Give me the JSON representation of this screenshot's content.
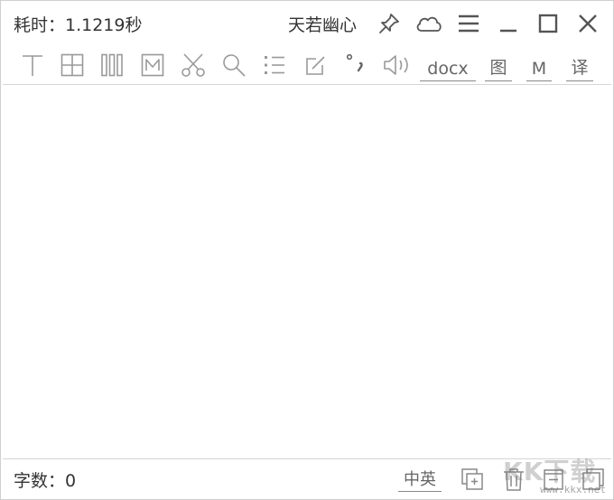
{
  "title": {
    "elapsed": "耗时：1.1219秒",
    "username": "天若幽心",
    "icons": [
      "pin-icon",
      "cloud-icon",
      "menu-icon",
      "minimize-icon",
      "maximize-icon",
      "close-icon"
    ]
  },
  "toolbar": {
    "icons": [
      "text-cursor-icon",
      "table-grid-icon",
      "columns-icon",
      "markdown-m-icon",
      "scissors-icon",
      "search-icon",
      "list-icon",
      "edit-icon",
      "punctuation-icon",
      "speaker-icon"
    ],
    "docx_label": "docx",
    "image_label": "图",
    "m_label": "M",
    "translate_label": "译"
  },
  "editor": {
    "value": ""
  },
  "status": {
    "char_count": "字数：0",
    "lang_toggle": "中英",
    "icons": [
      "add-copy-icon",
      "trash-icon",
      "minus-square-icon",
      "restore-icon"
    ]
  },
  "watermark": {
    "text": "KK下载",
    "url": "www.kkx.net"
  },
  "colors": {
    "icon": "#888888",
    "text": "#333333",
    "border": "#cfcfcf"
  }
}
